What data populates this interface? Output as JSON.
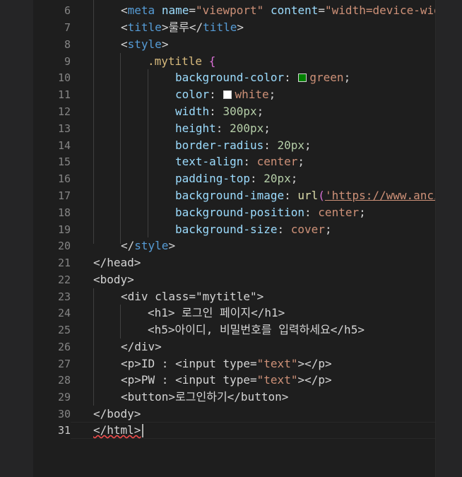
{
  "colors": {
    "background": "#1e1e1e",
    "tag": "#569cd6",
    "attribute": "#9cdcfe",
    "string": "#ce9178",
    "selector": "#d7ba7d",
    "number": "#b5cea8",
    "function": "#dcdcaa",
    "line_number": "#858585",
    "swatch_green": "#008000",
    "swatch_white": "#ffffff"
  },
  "line_numbers": [
    "6",
    "7",
    "8",
    "9",
    "10",
    "11",
    "12",
    "13",
    "14",
    "15",
    "16",
    "17",
    "18",
    "19",
    "20",
    "21",
    "22",
    "23",
    "24",
    "25",
    "26",
    "27",
    "28",
    "29",
    "30",
    "31"
  ],
  "lines": {
    "l6": {
      "open": "<",
      "tag": "meta",
      "sp1": " ",
      "a1": "name",
      "eq1": "=",
      "v1": "\"viewport\"",
      "sp2": " ",
      "a2": "content",
      "eq2": "=",
      "v2": "\"width=device-wid"
    },
    "l7": {
      "o1": "<",
      "tag": "title",
      "c1": ">",
      "text": "룰루",
      "o2": "</",
      "tag2": "title",
      "c2": ">"
    },
    "l8": {
      "o1": "<",
      "tag": "style",
      "c1": ">"
    },
    "l9": {
      "sel": ".mytitle",
      "sp": " ",
      "brace": "{"
    },
    "l10": {
      "prop": "background-color",
      "colon": ": ",
      "val": "green",
      "semi": ";"
    },
    "l11": {
      "prop": "color",
      "colon": ": ",
      "val": "white",
      "semi": ";"
    },
    "l12": {
      "prop": "width",
      "colon": ": ",
      "val": "300px",
      "semi": ";"
    },
    "l13": {
      "prop": "height",
      "colon": ": ",
      "val": "200px",
      "semi": ";"
    },
    "l14": {
      "prop": "border-radius",
      "colon": ": ",
      "val": "20px",
      "semi": ";"
    },
    "l15": {
      "prop": "text-align",
      "colon": ": ",
      "val": "center",
      "semi": ";"
    },
    "l16": {
      "prop": "padding-top",
      "colon": ": ",
      "val": "20px",
      "semi": ";"
    },
    "l17": {
      "prop": "background-image",
      "colon": ": ",
      "func": "url",
      "paren": "(",
      "url": "'https://www.anci"
    },
    "l18": {
      "prop": "background-position",
      "colon": ": ",
      "val": "center",
      "semi": ";"
    },
    "l19": {
      "prop": "background-size",
      "colon": ": ",
      "val": "cover",
      "semi": ";"
    },
    "l20": {
      "o1": "</",
      "tag": "style",
      "c1": ">"
    },
    "l21": {
      "text": "</head>"
    },
    "l22": {
      "text": "<body>"
    },
    "l23": {
      "pre": "<div class=",
      "str": "\"mytitle\"",
      "post": ">"
    },
    "l24": {
      "text": "<h1> 로그인 페이지</h1>"
    },
    "l25": {
      "text": "<h5>아이디, 비밀번호를 입력하세요</h5>"
    },
    "l26": {
      "text": "</div>"
    },
    "l27": {
      "pre": "<p>ID : <input type=",
      "str": "\"text\"",
      "post": "></p>"
    },
    "l28": {
      "pre": "<p>PW : <input type=",
      "str": "\"text\"",
      "post": "></p>"
    },
    "l29": {
      "text": "<button>로그인하기</button>"
    },
    "l30": {
      "text": "</body>"
    },
    "l31": {
      "text": "</html>"
    }
  }
}
